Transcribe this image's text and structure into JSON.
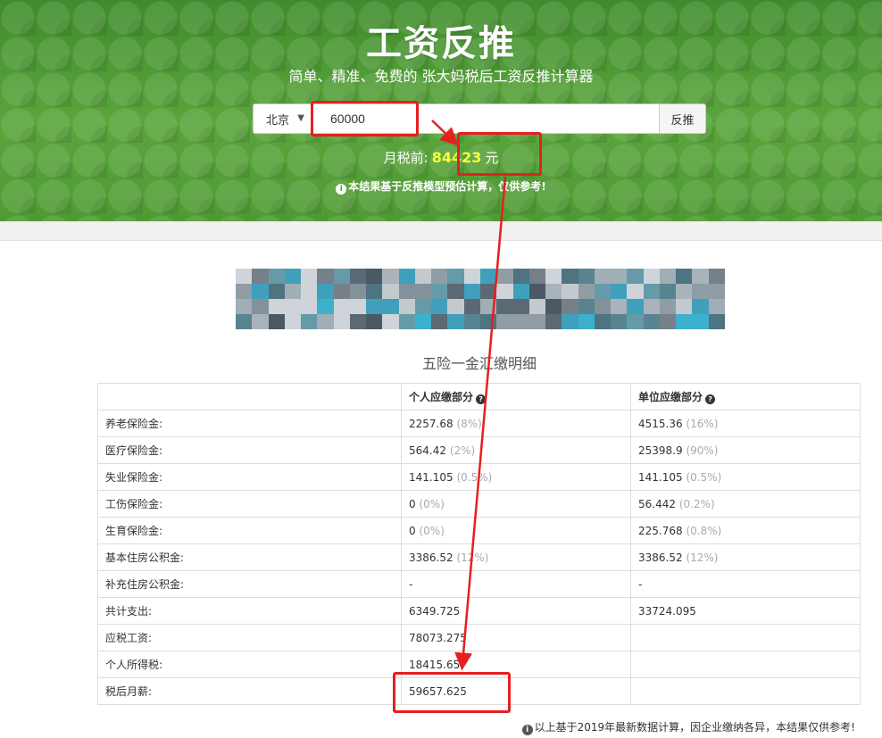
{
  "header": {
    "title": "工资反推",
    "subtitle": "简单、精准、免费的 张大妈税后工资反推计算器"
  },
  "search": {
    "city": "北京",
    "salary_value": "60000",
    "button_label": "反推"
  },
  "result": {
    "label": "月税前:",
    "value": "84423",
    "unit": "元",
    "note": "本结果基于反推模型预估计算，仅供参考!"
  },
  "table": {
    "caption": "五险一金汇缴明细",
    "headers": {
      "personal": "个人应缴部分",
      "company": "单位应缴部分"
    },
    "rows": [
      {
        "label": "养老保险金:",
        "personal": "2257.68",
        "personal_pct": "(8%)",
        "company": "4515.36",
        "company_pct": "(16%)"
      },
      {
        "label": "医疗保险金:",
        "personal": "564.42",
        "personal_pct": "(2%)",
        "company": "25398.9",
        "company_pct": "(90%)"
      },
      {
        "label": "失业保险金:",
        "personal": "141.105",
        "personal_pct": "(0.5%)",
        "company": "141.105",
        "company_pct": "(0.5%)"
      },
      {
        "label": "工伤保险金:",
        "personal": "0",
        "personal_pct": "(0%)",
        "company": "56.442",
        "company_pct": "(0.2%)"
      },
      {
        "label": "生育保险金:",
        "personal": "0",
        "personal_pct": "(0%)",
        "company": "225.768",
        "company_pct": "(0.8%)"
      },
      {
        "label": "基本住房公积金:",
        "personal": "3386.52",
        "personal_pct": "(12%)",
        "company": "3386.52",
        "company_pct": "(12%)"
      },
      {
        "label": "补充住房公积金:",
        "personal": "-",
        "personal_pct": "",
        "company": "-",
        "company_pct": ""
      },
      {
        "label": "共计支出:",
        "personal": "6349.725",
        "personal_pct": "",
        "company": "33724.095",
        "company_pct": ""
      },
      {
        "label": "应税工资:",
        "personal": "78073.275",
        "personal_pct": "",
        "company": "",
        "company_pct": ""
      },
      {
        "label": "个人所得税:",
        "personal": "18415.65",
        "personal_pct": "",
        "company": "",
        "company_pct": ""
      },
      {
        "label": "税后月薪:",
        "personal": "59657.625",
        "personal_pct": "",
        "company": "",
        "company_pct": ""
      }
    ]
  },
  "footer": {
    "note": "以上基于2019年最新数据计算，因企业缴纳各异，本结果仅供参考!"
  },
  "colors": {
    "hero_green": "#4f9a34",
    "highlight_yellow": "#ffff33",
    "annotation_red": "#e52020"
  }
}
